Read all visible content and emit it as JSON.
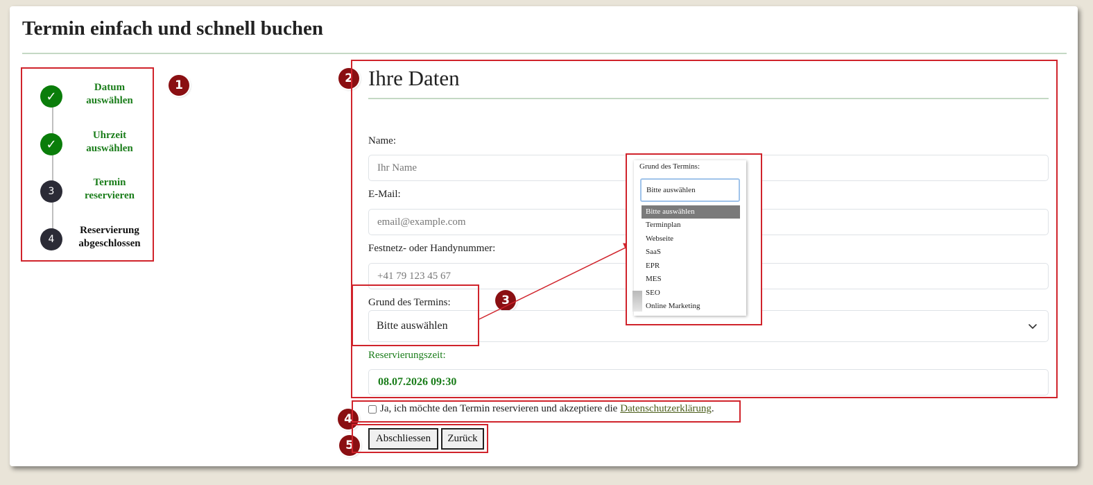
{
  "page": {
    "title": "Termin einfach und schnell buchen"
  },
  "stepper": {
    "steps": [
      {
        "label": "Datum auswählen",
        "line1": "Datum",
        "line2": "auswählen",
        "marker": "✓",
        "state": "done"
      },
      {
        "label": "Uhrzeit auswählen",
        "line1": "Uhrzeit",
        "line2": "auswählen",
        "marker": "✓",
        "state": "done"
      },
      {
        "label": "Termin reservieren",
        "line1": "Termin",
        "line2": "reservieren",
        "marker": "3",
        "state": "active"
      },
      {
        "label": "Reservierung abgeschlossen",
        "line1": "Reservierung",
        "line2": "abgeschlossen",
        "marker": "4",
        "state": "pending"
      }
    ]
  },
  "badges": [
    "1",
    "2",
    "3",
    "4",
    "5"
  ],
  "form": {
    "title": "Ihre Daten",
    "name": {
      "label": "Name:",
      "placeholder": "Ihr Name"
    },
    "email": {
      "label": "E-Mail:",
      "placeholder": "email@example.com"
    },
    "phone": {
      "label": "Festnetz- oder Handynummer:",
      "placeholder": "+41 79 123 45 67"
    },
    "reason": {
      "label": "Grund des Termins:",
      "value": "Bitte auswählen"
    },
    "reservation": {
      "label": "Reservierungszeit:",
      "value": "08.07.2026 09:30"
    }
  },
  "dropdown_preview": {
    "label": "Grund des Termins:",
    "selected": "Bitte auswählen",
    "options": [
      "Bitte auswählen",
      "Terminplan",
      "Webseite",
      "SaaS",
      "EPR",
      "MES",
      "SEO",
      "Online Marketing"
    ]
  },
  "consent": {
    "text": "Ja, ich möchte den Termin reservieren und akzeptiere die",
    "link": "Datenschutzerklärung",
    "suffix": "."
  },
  "buttons": {
    "finish": "Abschliessen",
    "back": "Zurück"
  },
  "colors": {
    "accent_green": "#1a7d1a",
    "annotation_red": "#d0232b",
    "badge": "#8a0f12"
  }
}
